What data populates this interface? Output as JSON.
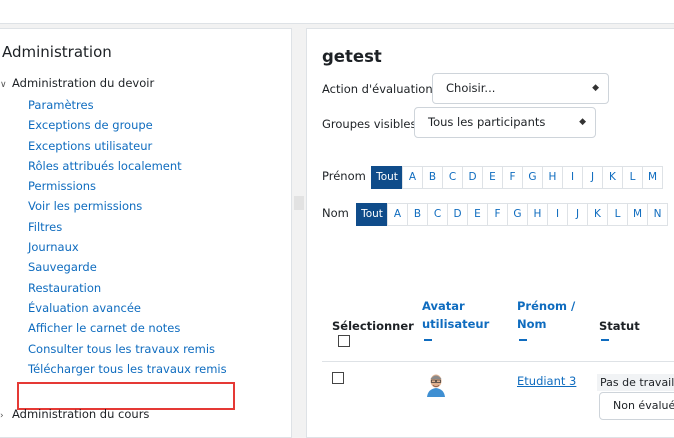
{
  "admin": {
    "title": "Administration",
    "section_assignment": "Administration du devoir",
    "links": [
      "Paramètres",
      "Exceptions de groupe",
      "Exceptions utilisateur",
      "Rôles attribués localement",
      "Permissions",
      "Voir les permissions",
      "Filtres",
      "Journaux",
      "Sauvegarde",
      "Restauration",
      "Évaluation avancée",
      "Afficher le carnet de notes",
      "Consulter tous les travaux remis",
      "Télécharger tous les travaux remis"
    ],
    "section_course": "Administration du cours",
    "highlight_color": "#e53935"
  },
  "main": {
    "title": "getest",
    "grading_action_label": "Action d'évaluation",
    "grading_action_value": "Choisir...",
    "groups_label": "Groupes visibles",
    "groups_value": "Tous les participants",
    "firstname_label": "Prénom",
    "lastname_label": "Nom",
    "all_label": "Tout",
    "firstname_letters": [
      "A",
      "B",
      "C",
      "D",
      "E",
      "F",
      "G",
      "H",
      "I",
      "J",
      "K",
      "L",
      "M"
    ],
    "lastname_letters": [
      "A",
      "B",
      "C",
      "D",
      "E",
      "F",
      "G",
      "H",
      "I",
      "J",
      "K",
      "L",
      "M",
      "N"
    ],
    "table": {
      "col_select": "Sélectionner",
      "col_avatar_1": "Avatar",
      "col_avatar_2": "utilisateur",
      "col_firstname_1": "Prénom /",
      "col_firstname_2": "Nom",
      "col_status": "Statut",
      "row": {
        "name": "Etudiant 3",
        "status": "Pas de travail remis",
        "grade": "Non évalué"
      }
    }
  },
  "colors": {
    "accent": "#0f6cbf",
    "active": "#0f4c8a"
  }
}
